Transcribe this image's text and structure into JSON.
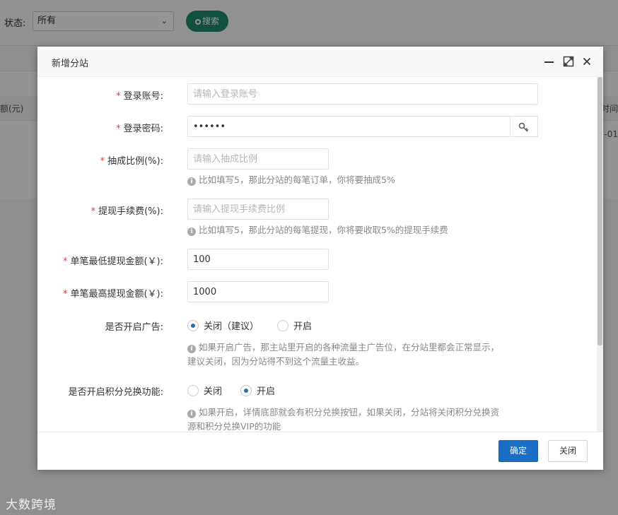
{
  "background": {
    "filter_label": "状态:",
    "status_select_value": "所有",
    "search_label": "搜索",
    "table_left_header": "额(元)",
    "table_right_header": "时间",
    "table_right_value": "-01"
  },
  "modal": {
    "title": "新增分站",
    "fields": {
      "account": {
        "label": "登录账号:",
        "required_mark": "*",
        "placeholder": "请输入登录账号",
        "value": ""
      },
      "password": {
        "label": "登录密码:",
        "required_mark": "*",
        "value": "••••••"
      },
      "commission": {
        "label": "抽成比例(%):",
        "required_mark": "*",
        "placeholder": "请输入抽成比例",
        "hint": "比如填写5，那此分站的每笔订单，你将要抽成5%"
      },
      "withdraw_fee": {
        "label": "提现手续费(%):",
        "required_mark": "*",
        "placeholder": "请输入提现手续费比例",
        "hint": "比如填写5，那此分站的每笔提现，你将要收取5%的提现手续费"
      },
      "min_withdraw": {
        "label": "单笔最低提现金额(￥):",
        "required_mark": "*",
        "value": "100"
      },
      "max_withdraw": {
        "label": "单笔最高提现金额(￥):",
        "required_mark": "*",
        "value": "1000"
      },
      "ads": {
        "label": "是否开启广告:",
        "options": [
          {
            "label": "关闭（建议）",
            "checked": true
          },
          {
            "label": "开启",
            "checked": false
          }
        ],
        "hint_line1": "如果开启广告，那主站里开启的各种流量主广告位，在分站里都会正常显示，",
        "hint_line2": "建议关闭，因为分站得不到这个流量主收益。"
      },
      "points": {
        "label": "是否开启积分兑换功能:",
        "options": [
          {
            "label": "关闭",
            "checked": false
          },
          {
            "label": "开启",
            "checked": true
          }
        ],
        "hint_line1": "如果开启，详情底部就会有积分兑换按钮，如果关闭，分站将关闭积分兑换资",
        "hint_line2": "源和积分兑换VIP的功能"
      }
    },
    "footer": {
      "ok_label": "确定",
      "close_label": "关闭"
    }
  },
  "watermark": "大数跨境",
  "colors": {
    "primary": "#1a6fc4",
    "search_button": "#1e8b6c",
    "required": "#e4393c"
  }
}
